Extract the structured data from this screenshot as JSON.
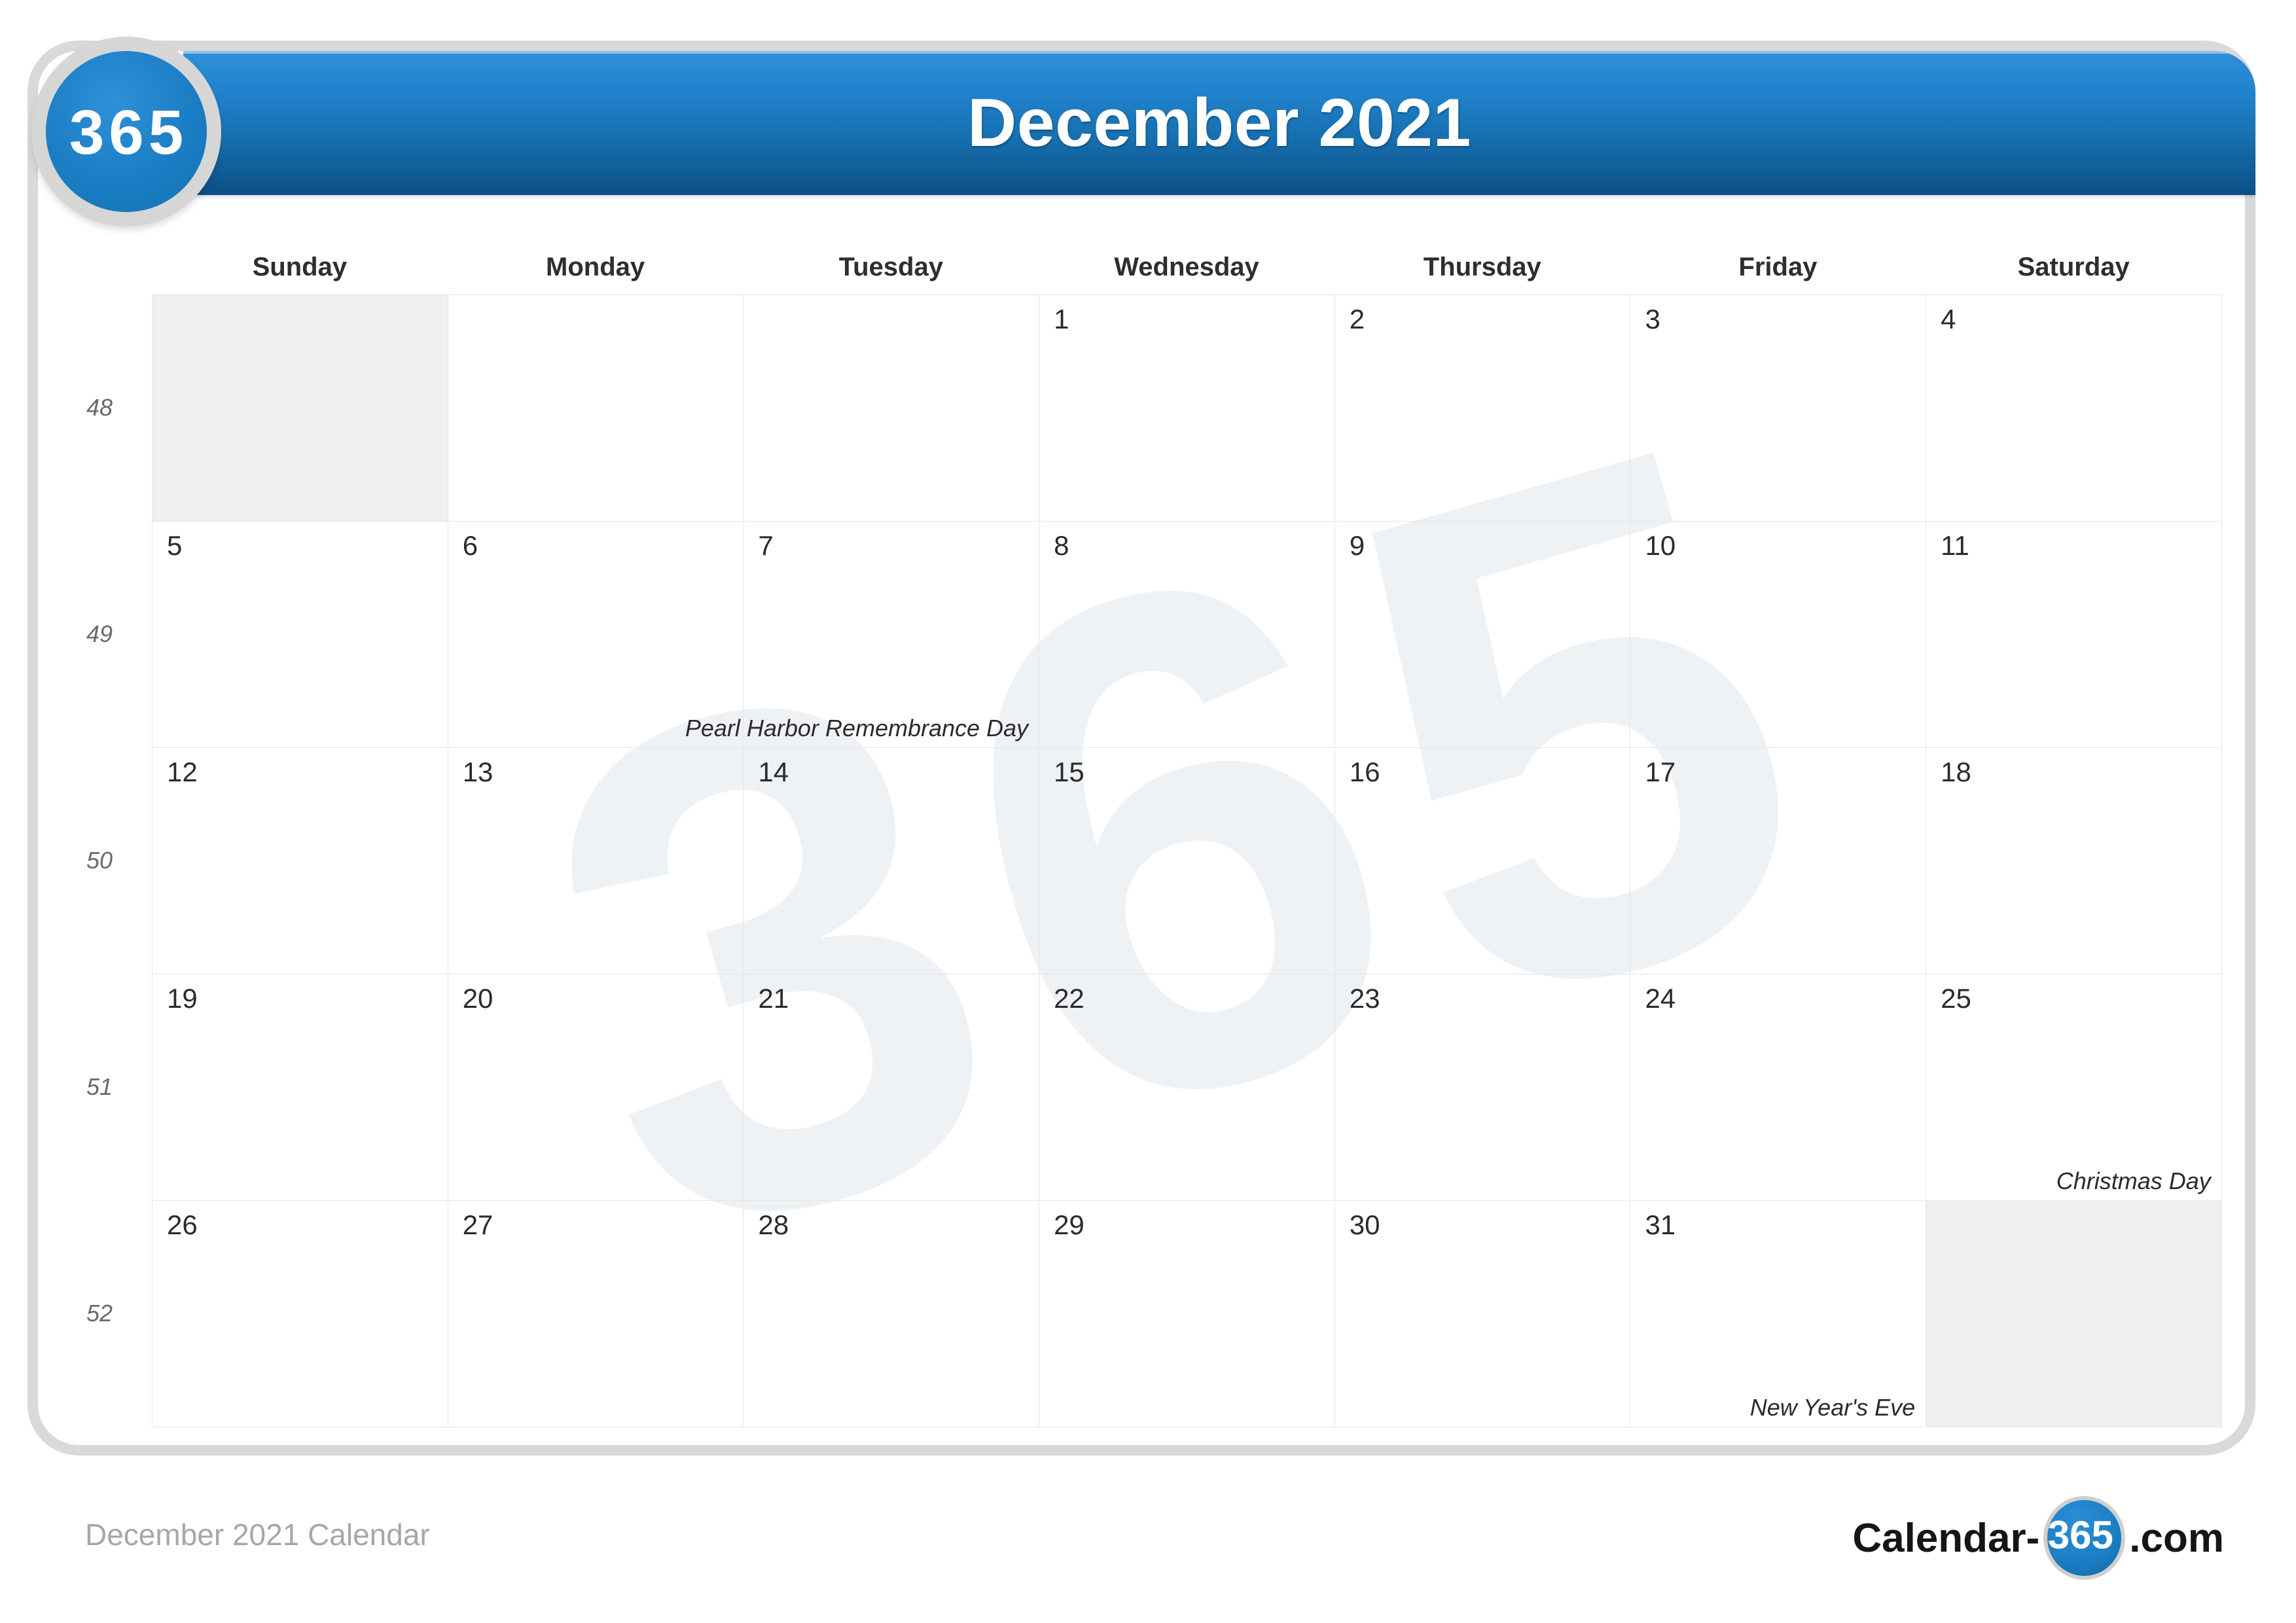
{
  "brand": {
    "logo_badge_text": "365",
    "footer_brand_prefix": "Calendar-",
    "footer_brand_oval": "365",
    "footer_brand_suffix": ".com",
    "accent_blue": "#1b7ec4",
    "header_gradient_top": "#2e90d8",
    "header_gradient_bottom": "#0c4f86",
    "holiday_fill": "#d3e9fb",
    "weekend_fill": "#efefef"
  },
  "header": {
    "title": "December 2021"
  },
  "footer": {
    "caption": "December 2021 Calendar"
  },
  "calendar": {
    "month": "December",
    "year": "2021",
    "weekday_headers": [
      "Sunday",
      "Monday",
      "Tuesday",
      "Wednesday",
      "Thursday",
      "Friday",
      "Saturday"
    ],
    "week_numbers": [
      "48",
      "49",
      "50",
      "51",
      "52"
    ],
    "weeks": [
      [
        {
          "day": "",
          "type": "weekend-blank"
        },
        {
          "day": "",
          "type": "blank"
        },
        {
          "day": "",
          "type": "blank"
        },
        {
          "day": "1",
          "type": "weekday"
        },
        {
          "day": "2",
          "type": "weekday"
        },
        {
          "day": "3",
          "type": "weekday"
        },
        {
          "day": "4",
          "type": "weekend"
        }
      ],
      [
        {
          "day": "5",
          "type": "weekend"
        },
        {
          "day": "6",
          "type": "weekday"
        },
        {
          "day": "7",
          "type": "holiday",
          "event": "Pearl Harbor Remembrance Day"
        },
        {
          "day": "8",
          "type": "weekday"
        },
        {
          "day": "9",
          "type": "weekday"
        },
        {
          "day": "10",
          "type": "weekday"
        },
        {
          "day": "11",
          "type": "weekend"
        }
      ],
      [
        {
          "day": "12",
          "type": "weekend"
        },
        {
          "day": "13",
          "type": "weekday"
        },
        {
          "day": "14",
          "type": "weekday"
        },
        {
          "day": "15",
          "type": "weekday"
        },
        {
          "day": "16",
          "type": "weekday"
        },
        {
          "day": "17",
          "type": "weekday"
        },
        {
          "day": "18",
          "type": "weekend"
        }
      ],
      [
        {
          "day": "19",
          "type": "weekend"
        },
        {
          "day": "20",
          "type": "weekday"
        },
        {
          "day": "21",
          "type": "weekday"
        },
        {
          "day": "22",
          "type": "weekday"
        },
        {
          "day": "23",
          "type": "weekday"
        },
        {
          "day": "24",
          "type": "weekday"
        },
        {
          "day": "25",
          "type": "holiday",
          "event": "Christmas Day"
        }
      ],
      [
        {
          "day": "26",
          "type": "weekend"
        },
        {
          "day": "27",
          "type": "weekday"
        },
        {
          "day": "28",
          "type": "weekday"
        },
        {
          "day": "29",
          "type": "weekday"
        },
        {
          "day": "30",
          "type": "weekday"
        },
        {
          "day": "31",
          "type": "holiday",
          "event": "New Year's Eve"
        },
        {
          "day": "",
          "type": "weekend-blank"
        }
      ]
    ],
    "holidays": [
      {
        "date": "7",
        "name": "Pearl Harbor Remembrance Day",
        "weekday": "Tuesday"
      },
      {
        "date": "25",
        "name": "Christmas Day",
        "weekday": "Saturday"
      },
      {
        "date": "31",
        "name": "New Year's Eve",
        "weekday": "Friday"
      }
    ],
    "watermark_text": "365"
  }
}
